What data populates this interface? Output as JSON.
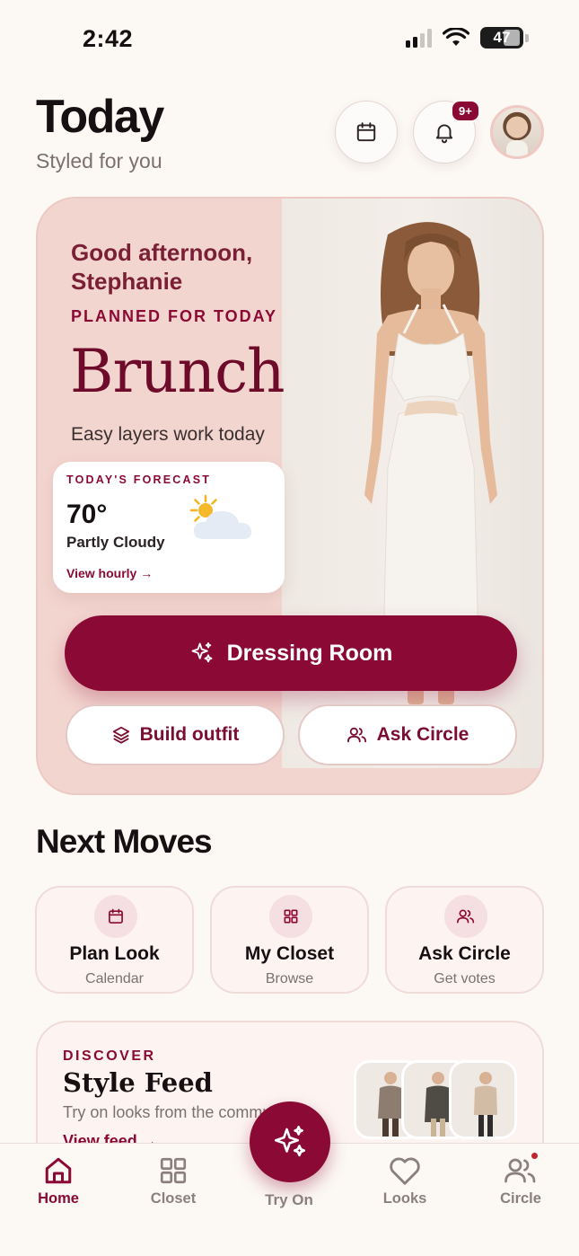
{
  "status_bar": {
    "time": "2:42",
    "battery": "47"
  },
  "header": {
    "title": "Today",
    "subtitle": "Styled for you",
    "notification_badge": "9+"
  },
  "hero": {
    "greeting": "Good afternoon, Stephanie",
    "planned_label": "PLANNED FOR TODAY",
    "event": "Brunch",
    "tip": "Easy layers work today",
    "forecast": {
      "label": "TODAY'S FORECAST",
      "temperature": "70°",
      "condition": "Partly Cloudy",
      "link": "View hourly →"
    },
    "dressing_room_label": "Dressing Room",
    "build_outfit_label": "Build outfit",
    "ask_circle_label": "Ask Circle"
  },
  "next_moves": {
    "title": "Next Moves",
    "cards": [
      {
        "title": "Plan Look",
        "subtitle": "Calendar",
        "icon": "calendar-icon"
      },
      {
        "title": "My Closet",
        "subtitle": "Browse",
        "icon": "grid-icon"
      },
      {
        "title": "Ask Circle",
        "subtitle": "Get votes",
        "icon": "people-icon"
      }
    ]
  },
  "discover": {
    "label": "DISCOVER",
    "title": "Style Feed",
    "description": "Try on looks from the community",
    "link": "View feed →"
  },
  "tab_bar": {
    "home": "Home",
    "closet": "Closet",
    "try_on": "Try On",
    "looks": "Looks",
    "circle": "Circle"
  },
  "colors": {
    "brand": "#8b0a35",
    "hero_bg": "#f3d5cf",
    "page_bg": "#fcf8f4",
    "muted_text": "#7b7170"
  }
}
